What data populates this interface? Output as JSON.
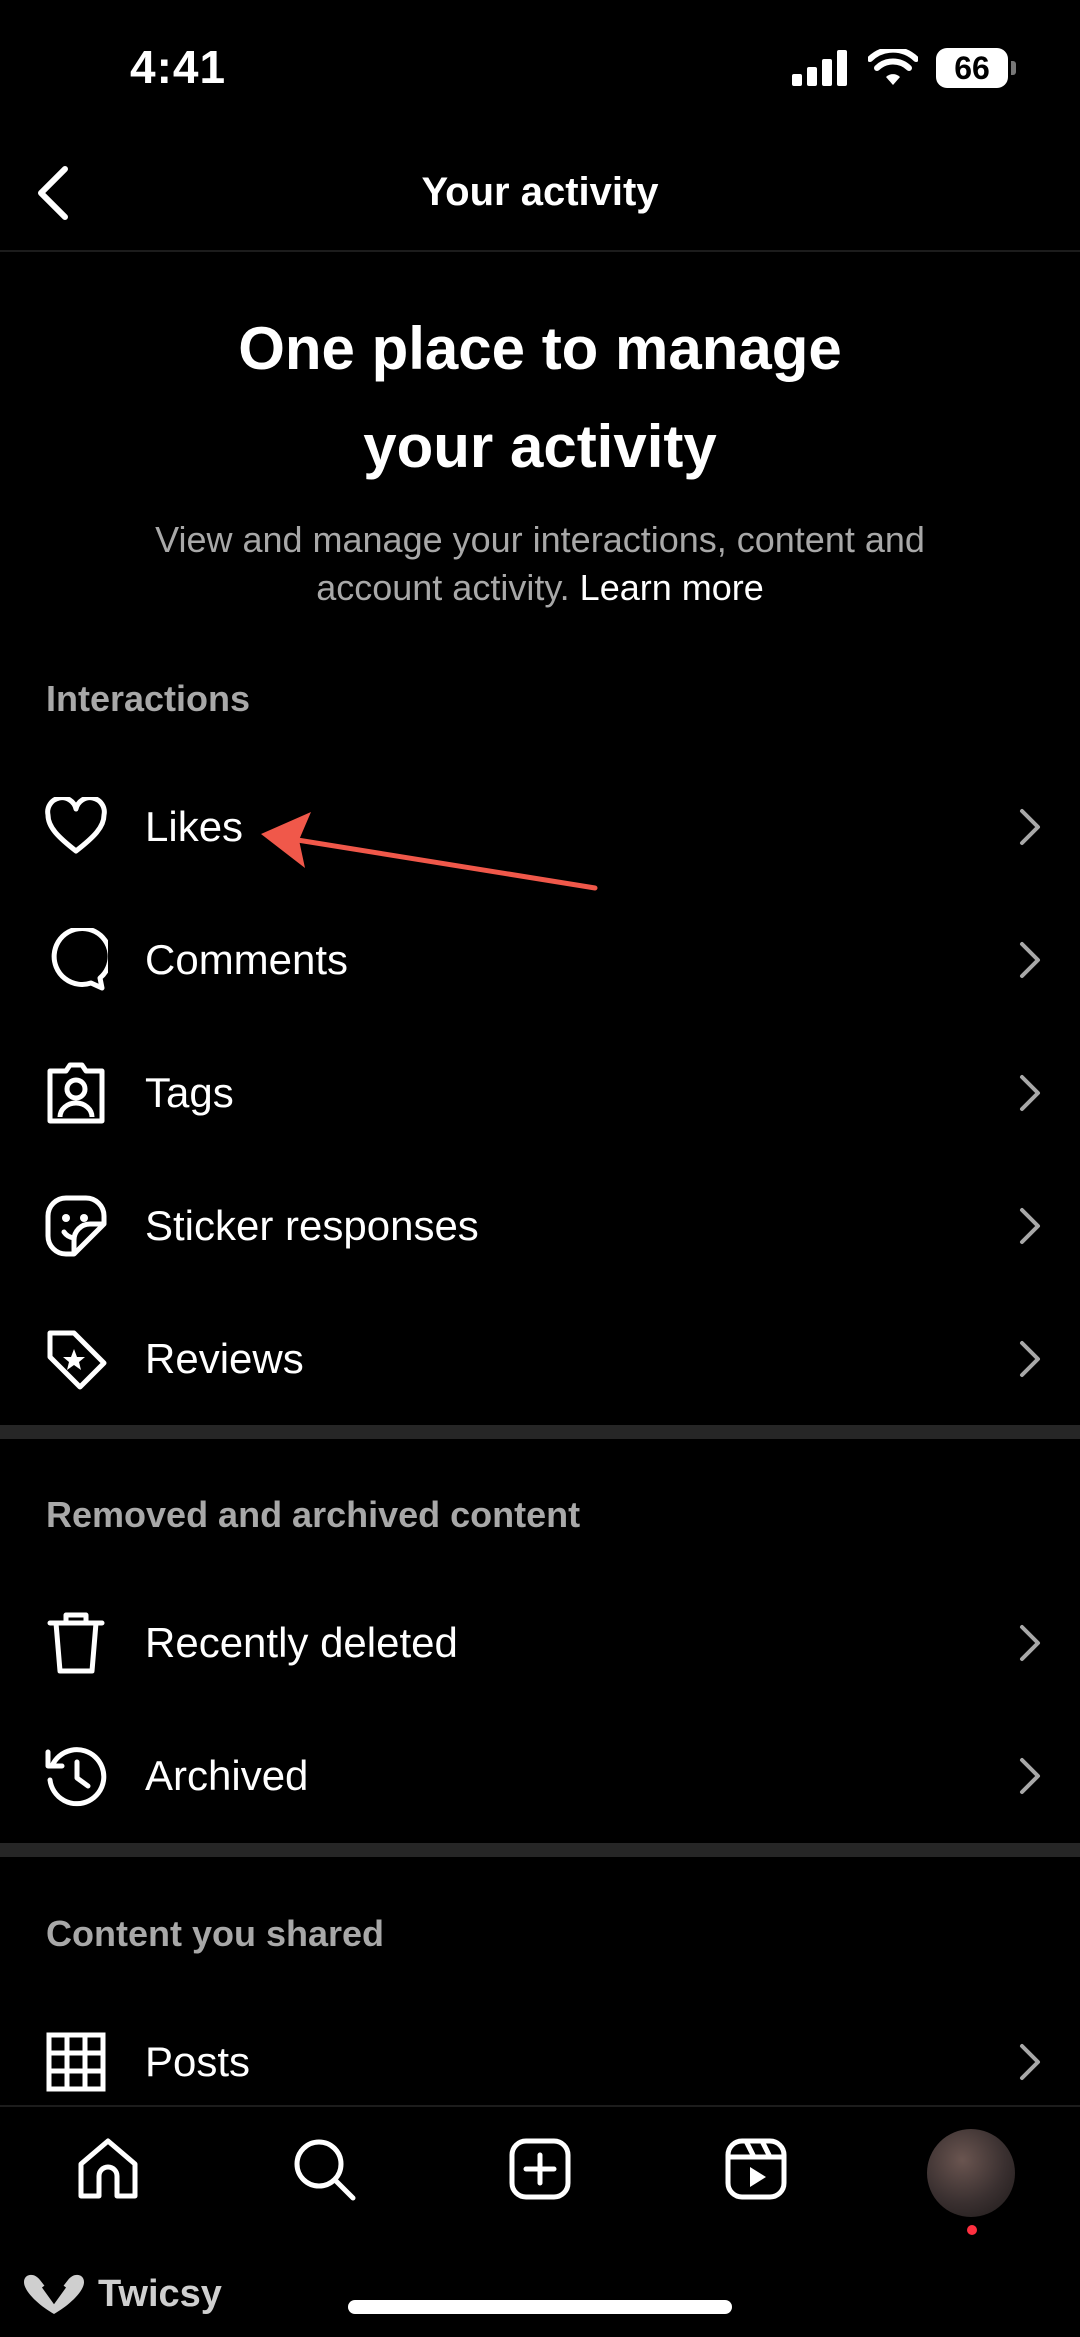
{
  "status_bar": {
    "time": "4:41",
    "battery": "66"
  },
  "header": {
    "title": "Your activity"
  },
  "hero": {
    "title": "One place to manage your activity",
    "description": "View and manage your interactions, content and account activity.",
    "learn_more": "Learn more"
  },
  "sections": [
    {
      "title": "Interactions",
      "items": [
        {
          "label": "Likes",
          "icon": "heart-icon"
        },
        {
          "label": "Comments",
          "icon": "comment-icon"
        },
        {
          "label": "Tags",
          "icon": "tag-person-icon"
        },
        {
          "label": "Sticker responses",
          "icon": "sticker-icon"
        },
        {
          "label": "Reviews",
          "icon": "star-tag-icon"
        }
      ]
    },
    {
      "title": "Removed and archived content",
      "items": [
        {
          "label": "Recently deleted",
          "icon": "trash-icon"
        },
        {
          "label": "Archived",
          "icon": "archive-history-icon"
        }
      ]
    },
    {
      "title": "Content you shared",
      "items": [
        {
          "label": "Posts",
          "icon": "grid-icon"
        }
      ]
    }
  ],
  "bottom_nav": [
    "home-icon",
    "search-icon",
    "create-icon",
    "reels-icon",
    "profile-avatar"
  ],
  "watermark": {
    "text": "Twicsy"
  },
  "colors": {
    "background": "#000000",
    "secondary_text": "#a8a8a8",
    "divider": "#262626",
    "annotation_arrow": "#f0584a",
    "notification_dot": "#ff3040"
  }
}
